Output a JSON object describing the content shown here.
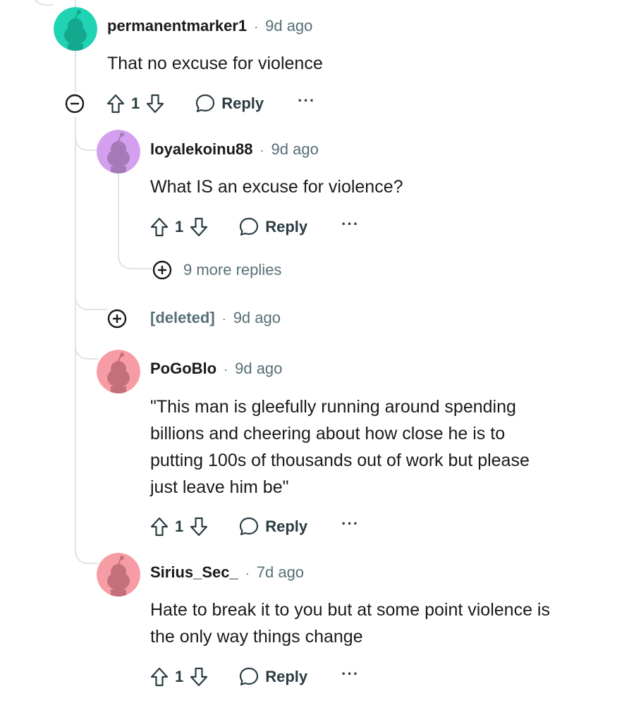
{
  "comments": [
    {
      "username": "permanentmarker1",
      "age": "9d ago",
      "body": "That no excuse for violence",
      "votes": "1",
      "reply_label": "Reply",
      "more_label": "···",
      "avatar_color": "#1fd3b4",
      "collapse_icon": "minus-circle-icon"
    },
    {
      "username": "loyalekoinu88",
      "age": "9d ago",
      "body": "What IS an excuse for violence?",
      "votes": "1",
      "reply_label": "Reply",
      "more_label": "···",
      "avatar_color": "#d59ff0",
      "more_replies": "9 more replies"
    },
    {
      "username": "[deleted]",
      "age": "9d ago",
      "expand_icon": "plus-circle-icon"
    },
    {
      "username": "PoGoBlo",
      "age": "9d ago",
      "body_lines": [
        "\"This man is gleefully running around spending",
        "billions and cheering about how close he is to",
        "putting 100s of thousands out of work but please",
        "just leave him be\""
      ],
      "votes": "1",
      "reply_label": "Reply",
      "more_label": "···",
      "avatar_color": "#f79ca5"
    },
    {
      "username": "Sirius_Sec_",
      "age": "7d ago",
      "body_lines": [
        "Hate to break it to you but at some point violence is",
        "the only way things change"
      ],
      "votes": "1",
      "reply_label": "Reply",
      "more_label": "···",
      "avatar_color": "#f79ca5"
    }
  ],
  "separator": "·",
  "colors": {
    "thread_line": "#dfe3e6",
    "meta_text": "#576f76",
    "text": "#1a1a1b"
  }
}
